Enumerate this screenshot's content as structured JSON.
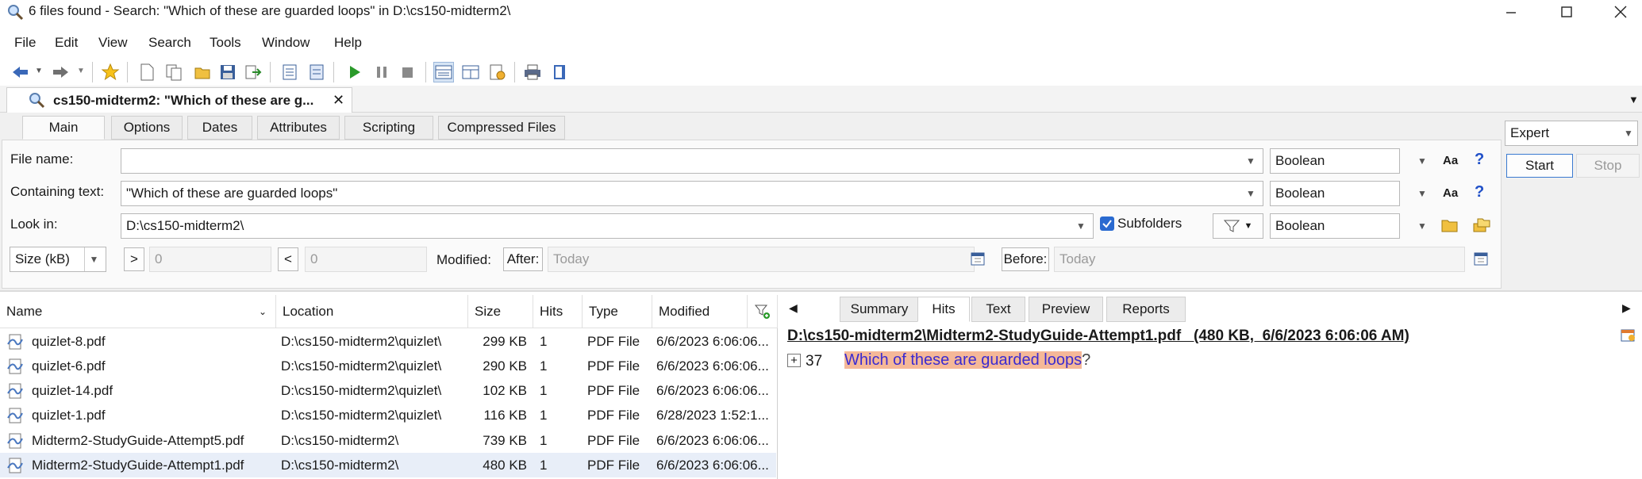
{
  "window": {
    "title": "6 files found - Search: \"Which of these are guarded loops\" in D:\\cs150-midterm2\\",
    "minimize_icon": "minimize-icon",
    "maximize_icon": "maximize-icon",
    "close_icon": "close-icon"
  },
  "menu": [
    "File",
    "Edit",
    "View",
    "Search",
    "Tools",
    "Window",
    "Help"
  ],
  "doc_tab": {
    "label": "cs150-midterm2: \"Which of these are g...",
    "close": "✕"
  },
  "sub_tabs": [
    "Main",
    "Options",
    "Dates",
    "Attributes",
    "Scripting",
    "Compressed Files"
  ],
  "form": {
    "file_name_label": "File name:",
    "file_name_value": "",
    "containing_label": "Containing text:",
    "containing_value": "\"Which of these are guarded loops\"",
    "look_in_label": "Look in:",
    "look_in_value": "D:\\cs150-midterm2\\",
    "subfolders_label": "Subfolders",
    "subfolders_checked": true,
    "mode1": "Boolean",
    "mode2": "Boolean",
    "mode3": "Boolean",
    "aa_label": "Aa",
    "help_label": "?",
    "size_unit": "Size (kB)",
    "gt_label": ">",
    "gt_value": "0",
    "lt_label": "<",
    "lt_value": "0",
    "modified_label": "Modified:",
    "after_label": "After:",
    "after_value": "Today",
    "before_label": "Before:",
    "before_value": "Today"
  },
  "right_panel": {
    "mode": "Expert",
    "start_label": "Start",
    "stop_label": "Stop"
  },
  "results": {
    "columns": [
      "Name",
      "Location",
      "Size",
      "Hits",
      "Type",
      "Modified"
    ],
    "rows": [
      {
        "name": "quizlet-8.pdf",
        "location": "D:\\cs150-midterm2\\quizlet\\",
        "size": "299 KB",
        "hits": "1",
        "type": "PDF File",
        "modified": "6/6/2023 6:06:06..."
      },
      {
        "name": "quizlet-6.pdf",
        "location": "D:\\cs150-midterm2\\quizlet\\",
        "size": "290 KB",
        "hits": "1",
        "type": "PDF File",
        "modified": "6/6/2023 6:06:06..."
      },
      {
        "name": "quizlet-14.pdf",
        "location": "D:\\cs150-midterm2\\quizlet\\",
        "size": "102 KB",
        "hits": "1",
        "type": "PDF File",
        "modified": "6/6/2023 6:06:06..."
      },
      {
        "name": "quizlet-1.pdf",
        "location": "D:\\cs150-midterm2\\quizlet\\",
        "size": "116 KB",
        "hits": "1",
        "type": "PDF File",
        "modified": "6/28/2023 1:52:1..."
      },
      {
        "name": "Midterm2-StudyGuide-Attempt5.pdf",
        "location": "D:\\cs150-midterm2\\",
        "size": "739 KB",
        "hits": "1",
        "type": "PDF File",
        "modified": "6/6/2023 6:06:06..."
      },
      {
        "name": "Midterm2-StudyGuide-Attempt1.pdf",
        "location": "D:\\cs150-midterm2\\",
        "size": "480 KB",
        "hits": "1",
        "type": "PDF File",
        "modified": "6/6/2023 6:06:06..."
      }
    ]
  },
  "preview": {
    "tabs": [
      "Summary",
      "Hits",
      "Text",
      "Preview",
      "Reports"
    ],
    "active_tab": "Hits",
    "file_header": "D:\\cs150-midterm2\\Midterm2-StudyGuide-Attempt1.pdf   (480 KB,  6/6/2023 6:06:06 AM)",
    "hit_line": "37",
    "hit_text": "Which of these are guarded loops",
    "hit_suffix": "?"
  },
  "colors": {
    "accent": "#2050c8",
    "highlight_bg": "#f5b898",
    "highlight_text": "#3b2bd0",
    "pdf_icon": "#4a78c0"
  }
}
